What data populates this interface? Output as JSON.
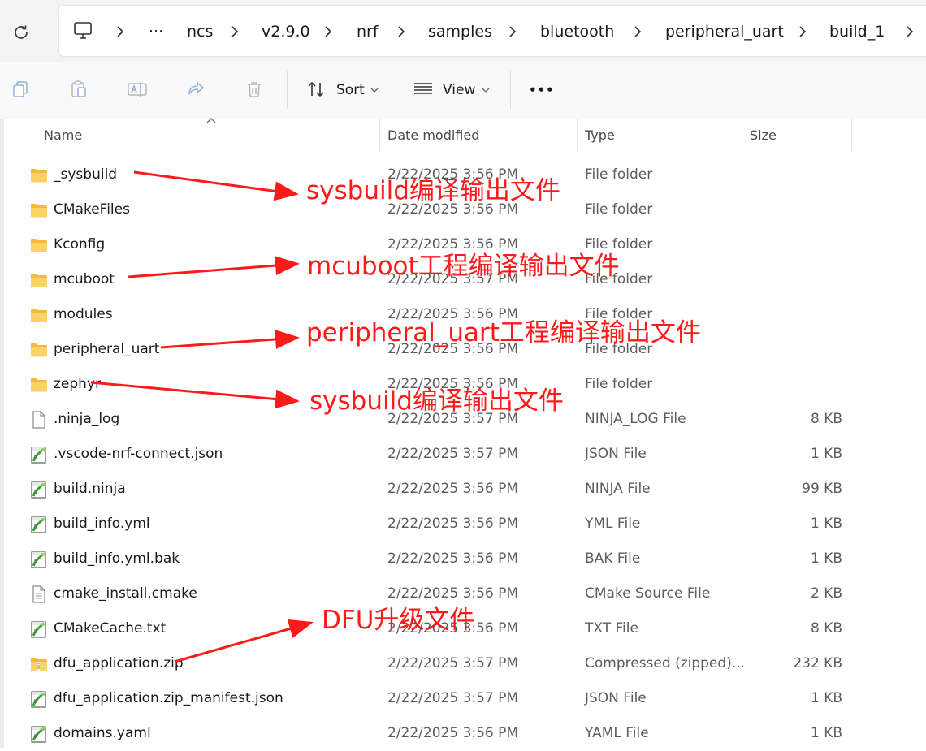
{
  "address_bar": {
    "crumbs": [
      "···",
      "ncs",
      "v2.9.0",
      "nrf",
      "samples",
      "bluetooth",
      "peripheral_uart",
      "build_1"
    ]
  },
  "toolbar": {
    "icons": [
      "copy-icon",
      "paste-icon",
      "rename-icon",
      "share-icon",
      "delete-icon"
    ],
    "sort_label": "Sort",
    "view_label": "View",
    "more_label": "•••"
  },
  "columns": {
    "name": "Name",
    "date": "Date modified",
    "type": "Type",
    "size": "Size"
  },
  "files": [
    {
      "name": "_sysbuild",
      "date": "2/22/2025 3:56 PM",
      "type": "File folder",
      "size": "",
      "icon": "folder-icon"
    },
    {
      "name": "CMakeFiles",
      "date": "2/22/2025 3:56 PM",
      "type": "File folder",
      "size": "",
      "icon": "folder-icon"
    },
    {
      "name": "Kconfig",
      "date": "2/22/2025 3:56 PM",
      "type": "File folder",
      "size": "",
      "icon": "folder-icon"
    },
    {
      "name": "mcuboot",
      "date": "2/22/2025 3:57 PM",
      "type": "File folder",
      "size": "",
      "icon": "folder-icon"
    },
    {
      "name": "modules",
      "date": "2/22/2025 3:56 PM",
      "type": "File folder",
      "size": "",
      "icon": "folder-icon"
    },
    {
      "name": "peripheral_uart",
      "date": "2/22/2025 3:56 PM",
      "type": "File folder",
      "size": "",
      "icon": "folder-icon"
    },
    {
      "name": "zephyr",
      "date": "2/22/2025 3:56 PM",
      "type": "File folder",
      "size": "",
      "icon": "folder-icon"
    },
    {
      "name": ".ninja_log",
      "date": "2/22/2025 3:57 PM",
      "type": "NINJA_LOG File",
      "size": "8 KB",
      "icon": "blank-file-icon"
    },
    {
      "name": ".vscode-nrf-connect.json",
      "date": "2/22/2025 3:57 PM",
      "type": "JSON File",
      "size": "1 KB",
      "icon": "notepadpp-file-icon"
    },
    {
      "name": "build.ninja",
      "date": "2/22/2025 3:56 PM",
      "type": "NINJA File",
      "size": "99 KB",
      "icon": "notepadpp-file-icon"
    },
    {
      "name": "build_info.yml",
      "date": "2/22/2025 3:56 PM",
      "type": "YML File",
      "size": "1 KB",
      "icon": "notepadpp-file-icon"
    },
    {
      "name": "build_info.yml.bak",
      "date": "2/22/2025 3:56 PM",
      "type": "BAK File",
      "size": "1 KB",
      "icon": "notepadpp-file-icon"
    },
    {
      "name": "cmake_install.cmake",
      "date": "2/22/2025 3:56 PM",
      "type": "CMake Source File",
      "size": "2 KB",
      "icon": "text-file-icon"
    },
    {
      "name": "CMakeCache.txt",
      "date": "2/22/2025 3:56 PM",
      "type": "TXT File",
      "size": "8 KB",
      "icon": "notepadpp-file-icon"
    },
    {
      "name": "dfu_application.zip",
      "date": "2/22/2025 3:57 PM",
      "type": "Compressed (zipped)...",
      "size": "232 KB",
      "icon": "zip-folder-icon"
    },
    {
      "name": "dfu_application.zip_manifest.json",
      "date": "2/22/2025 3:57 PM",
      "type": "JSON File",
      "size": "1 KB",
      "icon": "notepadpp-file-icon"
    },
    {
      "name": "domains.yaml",
      "date": "2/22/2025 3:56 PM",
      "type": "YAML File",
      "size": "1 KB",
      "icon": "notepadpp-file-icon"
    }
  ],
  "annotations": [
    {
      "text": "sysbuild编译输出文件",
      "target": "_sysbuild"
    },
    {
      "text": "mcuboot工程编译输出文件",
      "target": "mcuboot"
    },
    {
      "text": "peripheral_uart工程编译输出文件",
      "target": "peripheral_uart"
    },
    {
      "text": "sysbuild编译输出文件",
      "target": "zephyr"
    },
    {
      "text": "DFU升级文件",
      "target": "dfu_application.zip"
    }
  ],
  "colors": {
    "annotation": "#ff1a1a",
    "folder": "#f7c44a",
    "toolbar_bg": "#f9f9f9",
    "addressbar_bg": "#f3f3f3"
  }
}
